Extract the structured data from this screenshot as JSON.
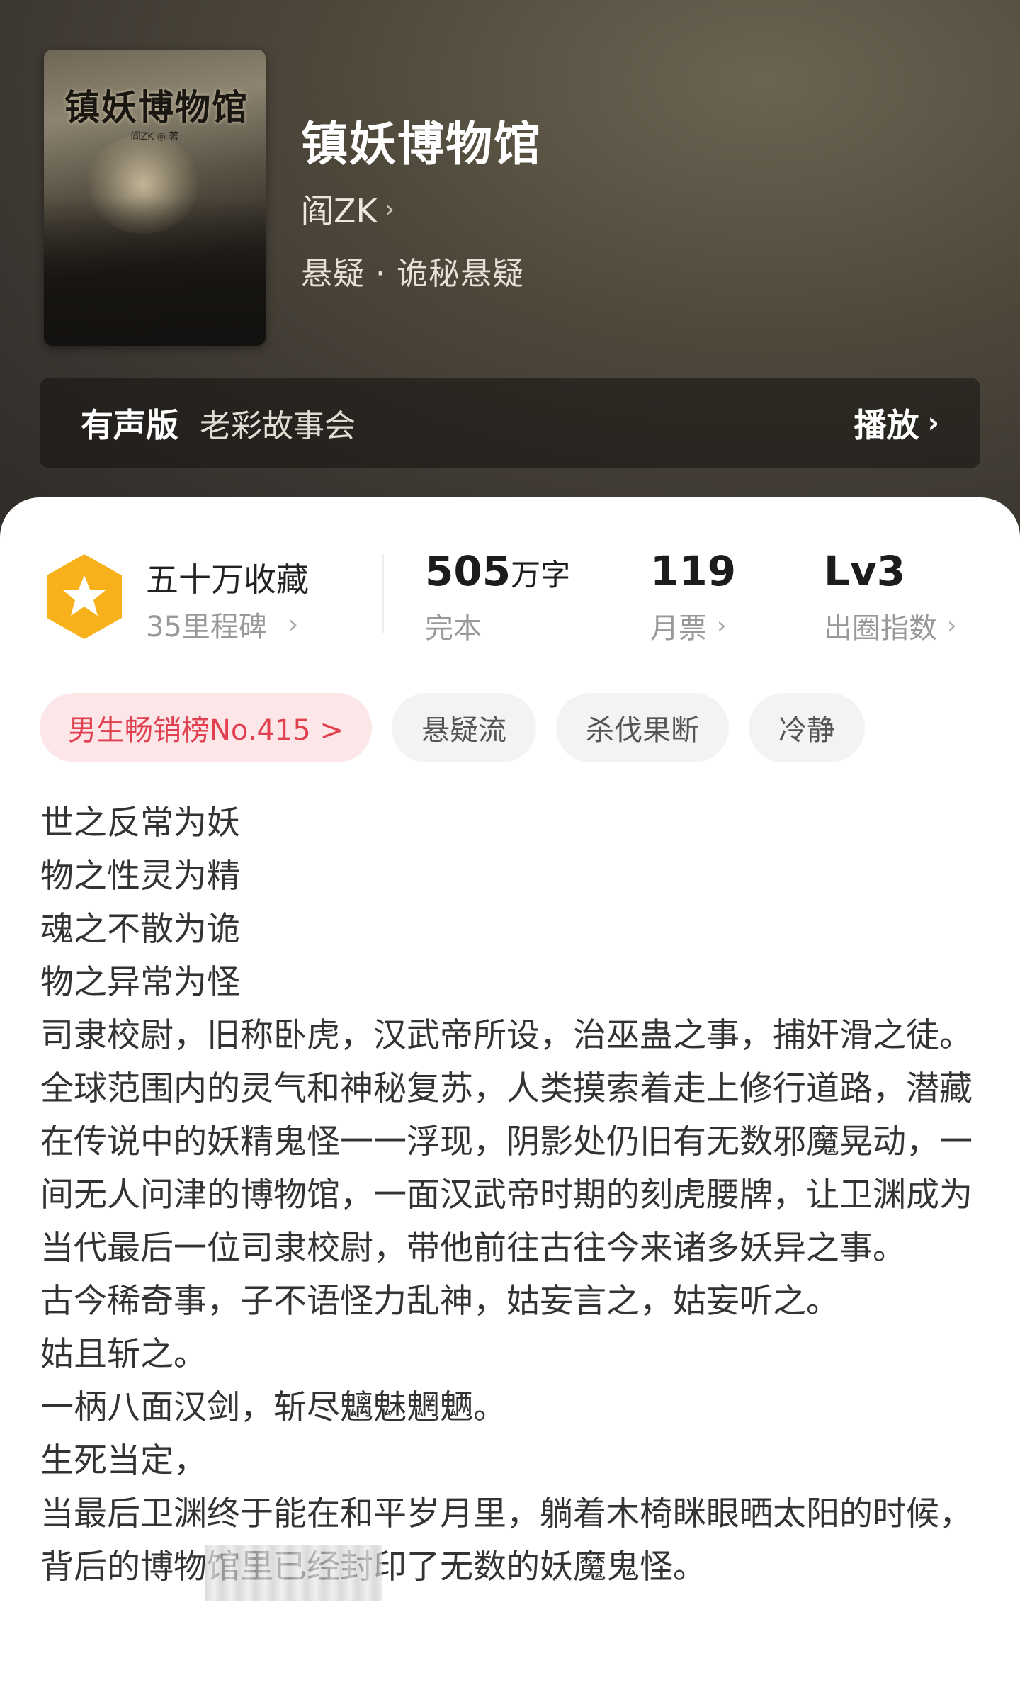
{
  "book": {
    "title": "镇妖博物馆",
    "cover_title": "镇妖博物馆",
    "cover_author": "阎ZK ◎ 著",
    "author": "阎ZK",
    "genre": "悬疑 · 诡秘悬疑"
  },
  "audio": {
    "tag": "有声版",
    "narrator": "老彩故事会",
    "play_label": "播放"
  },
  "stats": {
    "collect_title": "五十万收藏",
    "collect_sub": "35里程碑",
    "words_value": "505",
    "words_unit": "万字",
    "words_label": "完本",
    "tickets_value": "119",
    "tickets_label": "月票",
    "level_value": "Lv3",
    "level_label": "出圈指数"
  },
  "tags": {
    "rank": "男生畅销榜No.415 >",
    "items": [
      "悬疑流",
      "杀伐果断",
      "冷静"
    ]
  },
  "description": [
    "世之反常为妖",
    "物之性灵为精",
    "魂之不散为诡",
    "物之异常为怪",
    "司隶校尉，旧称卧虎，汉武帝所设，治巫蛊之事，捕奸滑之徒。",
    "全球范围内的灵气和神秘复苏，人类摸索着走上修行道路，潜藏在传说中的妖精鬼怪一一浮现，阴影处仍旧有无数邪魔晃动，一间无人问津的博物馆，一面汉武帝时期的刻虎腰牌，让卫渊成为当代最后一位司隶校尉，带他前往古往今来诸多妖异之事。",
    "古今稀奇事，子不语怪力乱神，姑妄言之，姑妄听之。",
    "姑且斩之。",
    "一柄八面汉剑，斩尽魑魅魍魉。",
    "生死当定，",
    "当最后卫渊终于能在和平岁月里，躺着木椅眯眼晒太阳的时候，背后的博物馆里已经封印了无数的妖魔鬼怪。"
  ],
  "colors": {
    "rank_text": "#e0404f",
    "rank_bg": "#fde6e8",
    "badge": "#f7b21b"
  },
  "icons": {
    "badge": "star-hexagon-icon",
    "chevron": "chevron-right-icon"
  }
}
